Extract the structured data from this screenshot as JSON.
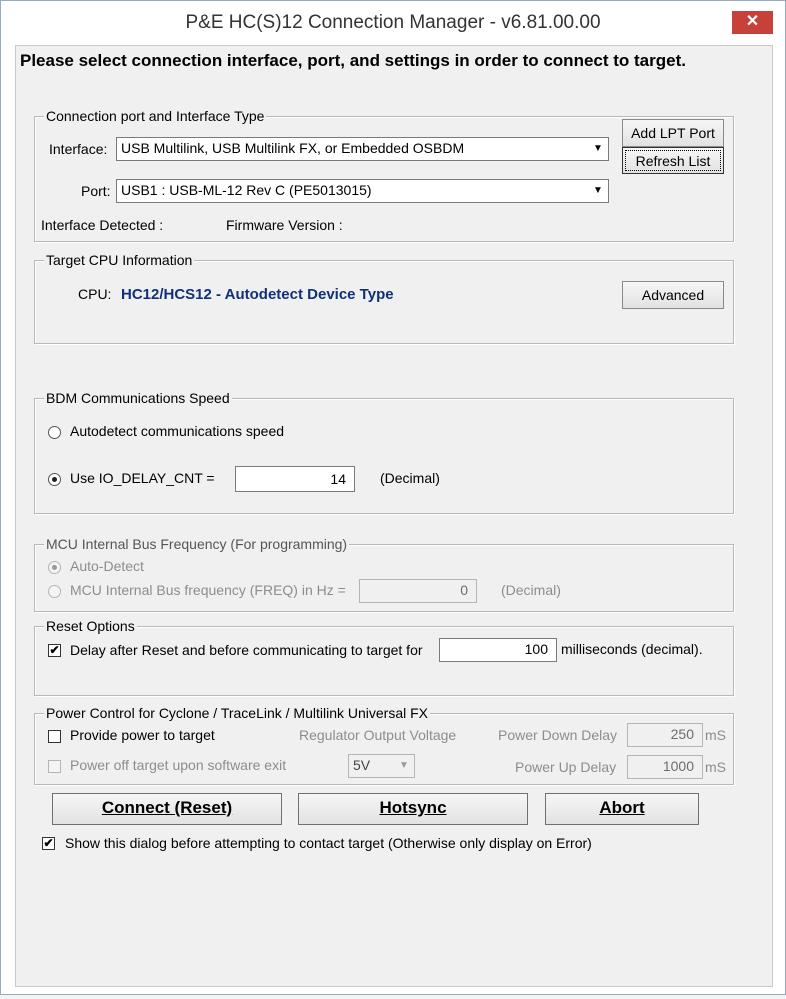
{
  "window": {
    "title": "P&E HC(S)12 Connection Manager - v6.81.00.00",
    "close_glyph": "✕"
  },
  "prompt": "Please select connection interface, port, and settings in order to connect to target.",
  "connection": {
    "legend": "Connection port and Interface Type",
    "interface_label": "Interface:",
    "interface_value": "USB Multilink, USB Multilink FX, or Embedded OSBDM",
    "port_label": "Port:",
    "port_value": "USB1 : USB-ML-12 Rev C (PE5013015)",
    "add_lpt_label": "Add LPT Port",
    "refresh_label": "Refresh List",
    "interface_detected_label": "Interface Detected :",
    "firmware_version_label": "Firmware Version :"
  },
  "target_cpu": {
    "legend": "Target CPU Information",
    "cpu_label": "CPU:",
    "cpu_value": "HC12/HCS12 - Autodetect Device Type",
    "advanced_label": "Advanced"
  },
  "bdm": {
    "legend": "BDM Communications Speed",
    "option_auto": "Autodetect communications speed",
    "option_io": "Use IO_DELAY_CNT =",
    "io_value": "14",
    "io_units": "(Decimal)",
    "selected": "io"
  },
  "mcu": {
    "legend": "MCU Internal Bus Frequency (For programming)",
    "option_auto": "Auto-Detect",
    "option_freq": "MCU Internal Bus frequency (FREQ) in Hz =",
    "freq_value": "0",
    "freq_units": "(Decimal)"
  },
  "reset": {
    "legend": "Reset Options",
    "delay_label": "Delay after Reset and before communicating to target for",
    "delay_value": "100",
    "delay_units": "milliseconds (decimal).",
    "delay_checked": true
  },
  "power": {
    "legend": "Power Control for Cyclone / TraceLink / Multilink Universal FX",
    "provide_power_label": "Provide power to target",
    "power_off_label": "Power off target upon software exit",
    "regulator_label": "Regulator Output Voltage",
    "voltage_value": "5V",
    "power_down_label": "Power Down Delay",
    "power_down_value": "250",
    "power_up_label": "Power Up Delay",
    "power_up_value": "1000",
    "unit_ms": "mS"
  },
  "actions": {
    "connect_label": "Connect (Reset)",
    "hotsync_label": "Hotsync",
    "abort_label": "Abort"
  },
  "show_dialog_label": "Show this dialog before attempting to contact target (Otherwise only display on Error)",
  "icons": {
    "checkmark": "✔",
    "dropdown": "▼"
  }
}
